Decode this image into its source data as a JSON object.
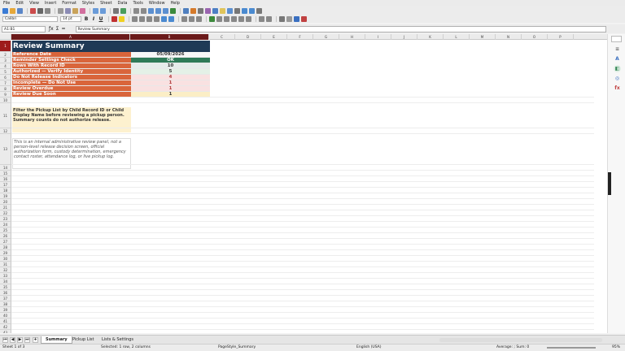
{
  "menu": [
    "File",
    "Edit",
    "View",
    "Insert",
    "Format",
    "Styles",
    "Sheet",
    "Data",
    "Tools",
    "Window",
    "Help"
  ],
  "toolbar": {
    "font_name": "Calibri",
    "font_size": "14 pt",
    "bold": "B",
    "italic": "I",
    "underline": "U"
  },
  "formula_bar": {
    "name_box": "A1:B1",
    "content": "Review Summary"
  },
  "columns": [
    "A",
    "B",
    "C",
    "D",
    "E",
    "F",
    "G",
    "H",
    "I",
    "J",
    "K",
    "L",
    "M",
    "N",
    "O",
    "P"
  ],
  "title": "Review Summary",
  "rows": [
    {
      "label": "Reference Date",
      "value": "05/09/2026",
      "bg": "#f7f7f7",
      "fg": "#333333"
    },
    {
      "label": "Reminder Settings Check",
      "value": "OK",
      "bg": "#2f7a58",
      "fg": "#ffffff"
    },
    {
      "label": "Rows With Record ID",
      "value": "10",
      "bg": "#e6eceb",
      "fg": "#333333"
    },
    {
      "label": "Authorized — Verify Identity",
      "value": "5",
      "bg": "#e4f1e7",
      "fg": "#333333"
    },
    {
      "label": "Do Not Release Indicators",
      "value": "4",
      "bg": "#f9e1e1",
      "fg": "#b03a3a"
    },
    {
      "label": "Incomplete — Do Not Use",
      "value": "1",
      "bg": "#f9e1e1",
      "fg": "#b03a3a"
    },
    {
      "label": "Review Overdue",
      "value": "1",
      "bg": "#f9e1e1",
      "fg": "#b03a3a"
    },
    {
      "label": "Review Due Soon",
      "value": "1",
      "bg": "#fbeec6",
      "fg": "#333333"
    }
  ],
  "note1": "Filter the Pickup List by Child Record ID or Child Display Name before reviewing a pickup person. Summary counts do not authorize release.",
  "note2": "This is an internal administrative review panel, not a person-level release decision screen, official authorization form, custody determination, emergency contact roster, attendance log, or live pickup log.",
  "row_numbers": [
    "1",
    "2",
    "3",
    "4",
    "5",
    "6",
    "7",
    "8",
    "9",
    "10",
    "11",
    "12",
    "13",
    "14",
    "15",
    "16",
    "17",
    "18",
    "19",
    "20",
    "21",
    "22",
    "23",
    "24",
    "25",
    "26",
    "27",
    "28",
    "29",
    "30",
    "31",
    "32",
    "33",
    "34",
    "35",
    "36",
    "37",
    "38",
    "39",
    "40",
    "41",
    "42",
    "43"
  ],
  "tabs": [
    "Summary",
    "Pickup List",
    "Lists & Settings"
  ],
  "status": {
    "sheet": "Sheet 1 of 3",
    "selected": "Selected: 1 row, 2 columns",
    "page_style": "PageStyle_Summary",
    "language": "English (USA)",
    "aggregate": "Average: ; Sum: 0",
    "zoom": "95%"
  },
  "colors": {
    "title_bg": "#1f3a56",
    "label_bg": "#d9653b",
    "header_a_bg": "#6b1a1a"
  }
}
